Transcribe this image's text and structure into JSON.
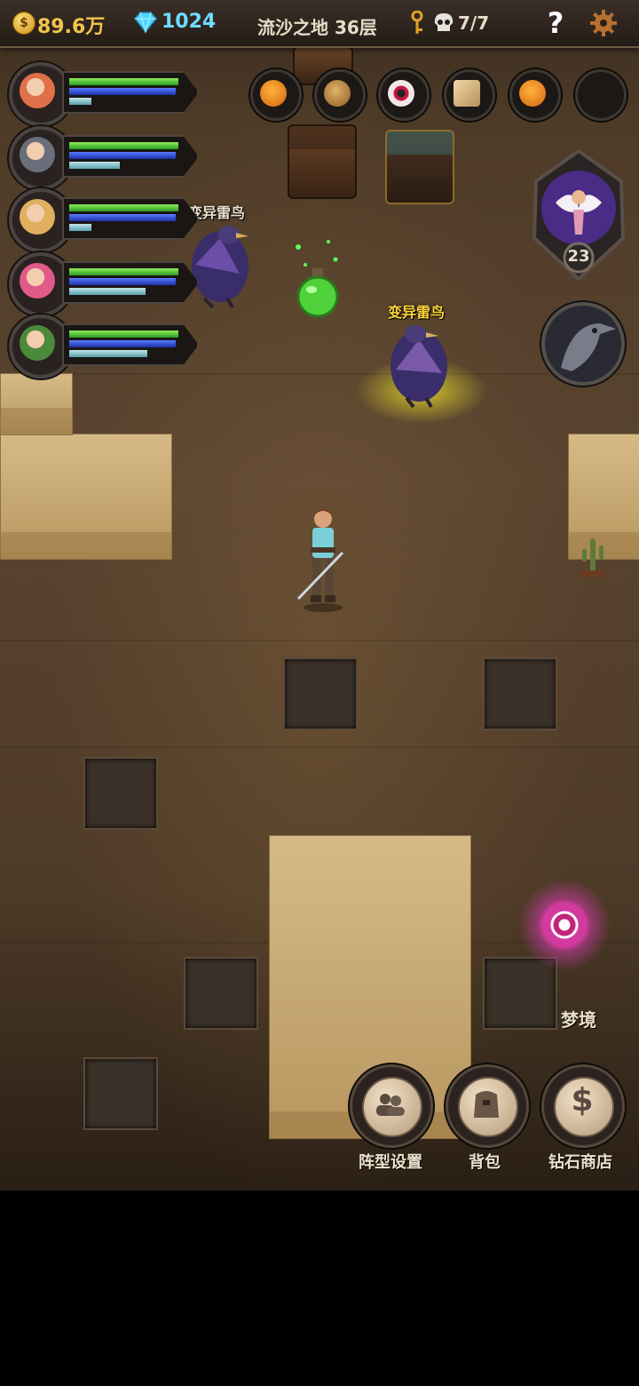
{
  "topbar": {
    "gold": "89.6万",
    "gems": "1024",
    "location": "流沙之地 36层",
    "kills": "7/7",
    "help": "?"
  },
  "heroes": [
    {
      "hp": 0.98,
      "mp": 0.95,
      "xp": 0.2
    },
    {
      "hp": 0.98,
      "mp": 0.95,
      "xp": 0.45
    },
    {
      "hp": 0.98,
      "mp": 0.95,
      "xp": 0.2
    },
    {
      "hp": 0.98,
      "mp": 0.95,
      "xp": 0.68
    },
    {
      "hp": 0.98,
      "mp": 0.95,
      "xp": 0.7
    }
  ],
  "items": [
    "pumpkin-icon",
    "acorn-icon",
    "eyeball-icon",
    "rune-cube-icon",
    "pumpkin-icon",
    "empty-slot"
  ],
  "monsters": [
    {
      "name": "变异雷鸟",
      "color": "#e8e2d0"
    },
    {
      "name": "变异雷鸟",
      "color": "#ffd63a"
    }
  ],
  "companion": {
    "level": "23"
  },
  "portal": {
    "label": "梦境"
  },
  "buttons": {
    "formation": "阵型设置",
    "bag": "背包",
    "shop": "钻石商店"
  },
  "colors": {
    "hp": "#5ecb3a",
    "mp": "#2c49d8",
    "xp": "#8ccfd6",
    "elite_glow": "#e6dc28"
  }
}
